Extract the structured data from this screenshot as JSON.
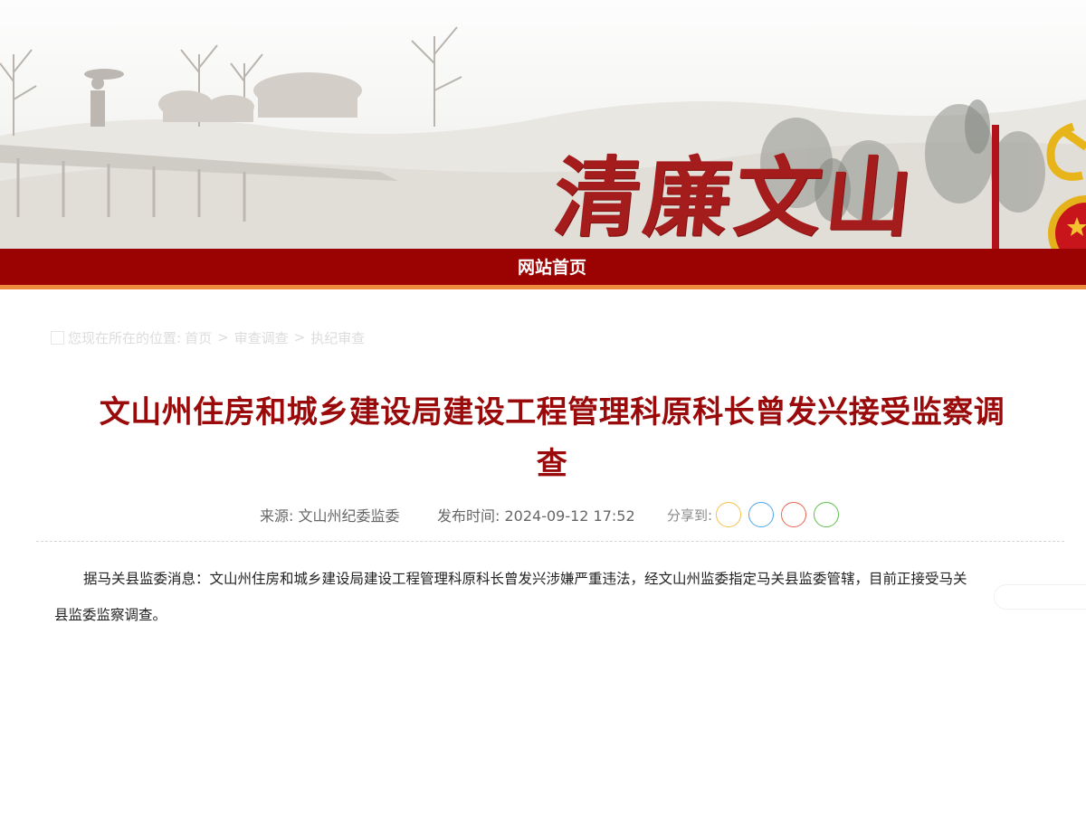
{
  "banner": {
    "brand_title": "清廉文山"
  },
  "nav": {
    "home_label": "网站首页"
  },
  "breadcrumb": {
    "prefix": "您现在所在的位置:",
    "items": [
      "首页",
      "审查调查",
      "执纪审查"
    ],
    "separator": ">"
  },
  "article": {
    "title": "文山州住房和城乡建设局建设工程管理科原科长曾发兴接受监察调查",
    "source": "来源: 文山州纪委监委",
    "publish_time": "发布时间: 2024-09-12 17:52",
    "share_label": "分享到:",
    "share_icons": [
      "qzone-icon",
      "qq-icon",
      "weibo-icon",
      "wechat-icon"
    ],
    "body": "据马关县监委消息：文山州住房和城乡建设局建设工程管理科原科长曾发兴涉嫌严重违法，经文山州监委指定马关县监委管辖，目前正接受马关县监委监察调查。"
  },
  "colors": {
    "brand_red": "#9b0303",
    "title_red": "#9a0a0a",
    "accent_orange": "#ee8a3b"
  }
}
